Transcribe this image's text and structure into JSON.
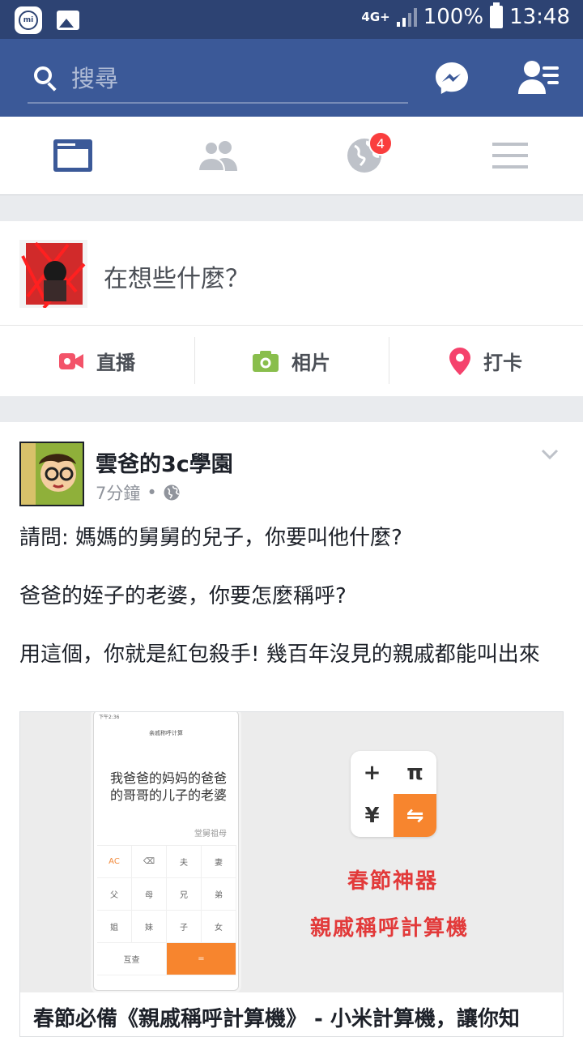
{
  "status_bar": {
    "network": "4G+",
    "battery": "100%",
    "time": "13:48"
  },
  "header": {
    "search_placeholder": "搜尋"
  },
  "tabs": {
    "notifications_badge": "4"
  },
  "composer": {
    "prompt": "在想些什麼？",
    "actions": {
      "live": "直播",
      "photo": "相片",
      "checkin": "打卡"
    }
  },
  "post": {
    "author": "雲爸的3c學園",
    "time": "7分鐘",
    "text": [
      "請問: 媽媽的舅舅的兒子，你要叫他什麼?",
      "爸爸的姪子的老婆，你要怎麼稱呼?",
      "用這個，你就是紅包殺手! 幾百年沒見的親戚都能叫出來"
    ],
    "preview": {
      "phone": {
        "status_time": "下午2:36",
        "title": "亲戚称呼计算",
        "expression": "我爸爸的妈妈的爸爸的哥哥的儿子的老婆",
        "result": "堂舅祖母",
        "keys": [
          "AC",
          "⌫",
          "夫",
          "妻",
          "父",
          "母",
          "兄",
          "弟",
          "姐",
          "妹",
          "子",
          "女",
          "互查",
          "="
        ]
      },
      "calc_icon": [
        "+",
        "π",
        "¥",
        "⇋"
      ],
      "promo_line1": "春節神器",
      "promo_line2": "親戚稱呼計算機",
      "caption": "春節必備《親戚稱呼計算機》 - 小米計算機，讓你知"
    }
  },
  "colors": {
    "header": "#3b5998",
    "status_bar": "#2d4373",
    "badge": "#fa3e3e",
    "live": "#f35369",
    "photo": "#89be4c",
    "checkin": "#f5426c",
    "promo": "#e23a3a"
  }
}
